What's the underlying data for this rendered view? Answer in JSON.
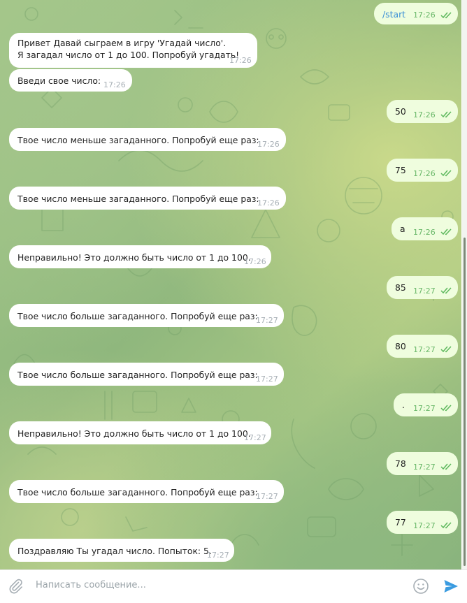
{
  "messages": [
    {
      "dir": "out",
      "text": "/start",
      "time": "17:26",
      "command": true
    },
    {
      "dir": "in",
      "lines": [
        "Привет Давай сыграем в игру 'Угадай число'.",
        "Я загадал число от 1 до 100. Попробуй угадать!"
      ],
      "time": "17:26"
    },
    {
      "dir": "in",
      "text": "Введи свое число:",
      "time": "17:26"
    },
    {
      "dir": "out",
      "text": "50",
      "time": "17:26"
    },
    {
      "dir": "in",
      "text": "Твое число меньше загаданного. Попробуй еще раз:",
      "time": "17:26"
    },
    {
      "dir": "out",
      "text": "75",
      "time": "17:26"
    },
    {
      "dir": "in",
      "text": "Твое число меньше загаданного. Попробуй еще раз:",
      "time": "17:26"
    },
    {
      "dir": "out",
      "text": "а",
      "time": "17:26"
    },
    {
      "dir": "in",
      "text": "Неправильно! Это должно быть число от 1 до 100.",
      "time": "17:26"
    },
    {
      "dir": "out",
      "text": "85",
      "time": "17:27"
    },
    {
      "dir": "in",
      "text": "Твое число больше загаданного. Попробуй еще раз:",
      "time": "17:27"
    },
    {
      "dir": "out",
      "text": "80",
      "time": "17:27"
    },
    {
      "dir": "in",
      "text": "Твое число больше загаданного. Попробуй еще раз:",
      "time": "17:27"
    },
    {
      "dir": "out",
      "text": ".",
      "time": "17:27"
    },
    {
      "dir": "in",
      "text": "Неправильно! Это должно быть число от 1 до 100.",
      "time": "17:27"
    },
    {
      "dir": "out",
      "text": "78",
      "time": "17:27"
    },
    {
      "dir": "in",
      "text": "Твое число больше загаданного. Попробуй еще раз:",
      "time": "17:27"
    },
    {
      "dir": "out",
      "text": "77",
      "time": "17:27"
    },
    {
      "dir": "in",
      "text": "Поздравляю Ты угадал число. Попыток: 5.",
      "time": "17:27"
    }
  ],
  "composer": {
    "placeholder": "Написать сообщение...",
    "attach_icon": "paperclip-icon",
    "emoji_icon": "smiley-icon",
    "send_icon": "send-arrow-icon"
  },
  "colors": {
    "incoming_bubble": "#ffffff",
    "outgoing_bubble": "#effdde",
    "outgoing_meta": "#6bb86a",
    "command_link": "#3a8fd6",
    "send_button": "#3a9be0"
  }
}
